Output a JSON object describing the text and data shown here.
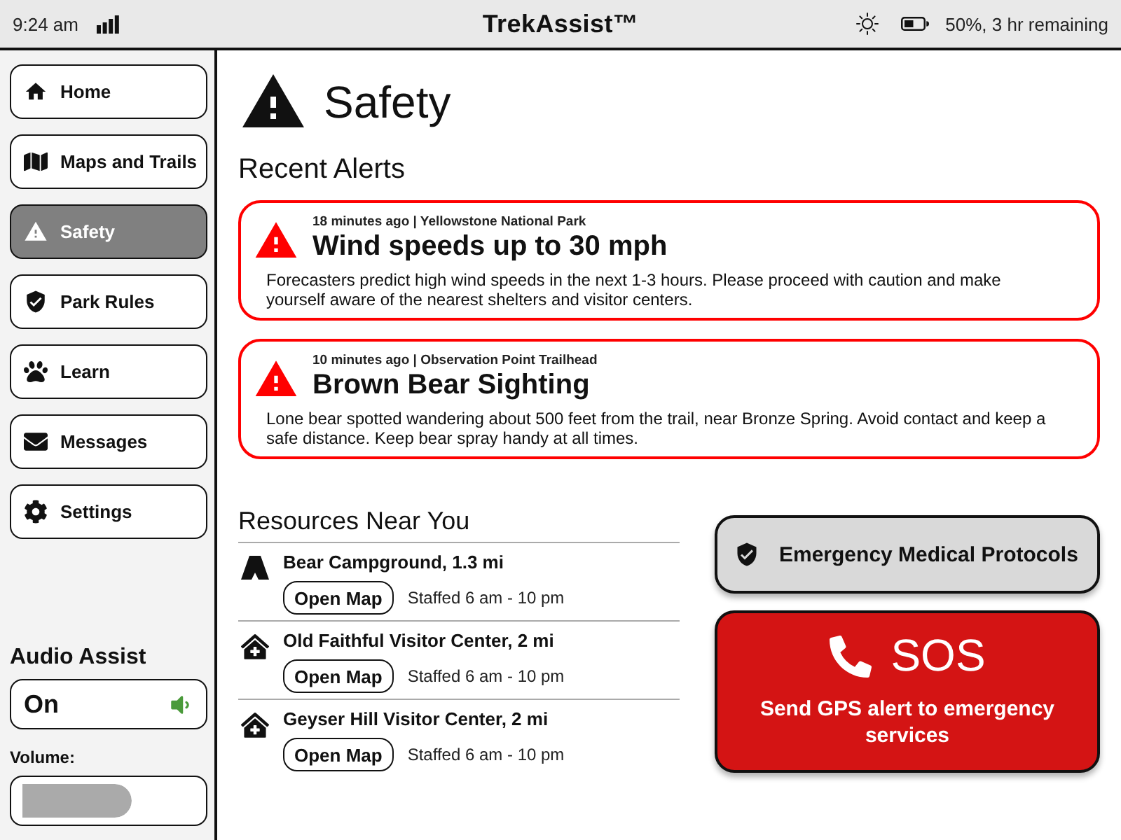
{
  "status_bar": {
    "time": "9:24 am",
    "title": "TrekAssist™",
    "battery": "50%, 3 hr remaining"
  },
  "sidebar": {
    "items": [
      {
        "label": "Home",
        "selected": false
      },
      {
        "label": "Maps and Trails",
        "selected": false
      },
      {
        "label": "Safety",
        "selected": true
      },
      {
        "label": "Park Rules",
        "selected": false
      },
      {
        "label": "Learn",
        "selected": false
      },
      {
        "label": "Messages",
        "selected": false
      },
      {
        "label": "Settings",
        "selected": false
      }
    ],
    "audio": {
      "heading": "Audio Assist",
      "toggle": {
        "label": "On",
        "on": true
      },
      "volume": {
        "label": "Volume:",
        "level": 0.62
      }
    }
  },
  "page": {
    "title": "Safety"
  },
  "alerts": {
    "heading": "Recent Alerts",
    "items": [
      {
        "meta": "18 minutes ago | Yellowstone National Park",
        "title": "Wind speeds up to 30 mph",
        "body": "Forecasters predict high wind speeds in the next 1-3 hours. Please proceed with caution and make yourself aware of the nearest shelters and visitor centers."
      },
      {
        "meta": "10 minutes ago | Observation Point Trailhead",
        "title": "Brown Bear Sighting",
        "body": "Lone bear spotted wandering about 500 feet from the trail, near Bronze Spring. Avoid contact and keep a safe distance. Keep bear spray handy at all times."
      }
    ]
  },
  "resources": {
    "heading": "Resources Near You",
    "items": [
      {
        "kind": "campground",
        "name": "Bear Campground, 1.3 mi",
        "button": "Open Map",
        "hours": "Staffed 6 am - 10 pm"
      },
      {
        "kind": "visitor_center",
        "name": "Old Faithful Visitor Center, 2 mi",
        "button": "Open Map",
        "hours": "Staffed 6 am - 10 pm"
      },
      {
        "kind": "visitor_center",
        "name": "Geyser Hill Visitor Center, 2 mi",
        "button": "Open Map",
        "hours": "Staffed 6 am - 10 pm"
      }
    ]
  },
  "actions": {
    "protocols": {
      "label": "Emergency Medical Protocols"
    },
    "sos": {
      "label": "SOS",
      "caption": "Send GPS alert to emergency services"
    }
  }
}
